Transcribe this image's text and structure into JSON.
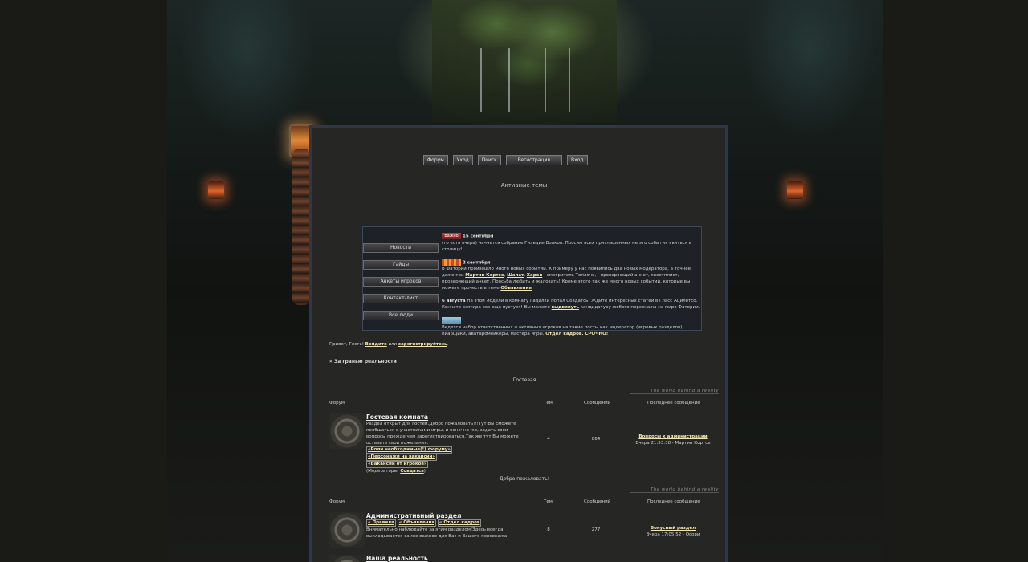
{
  "topnav": [
    "Форум",
    "Уход",
    "Поиск",
    "Регистрация",
    "Вход"
  ],
  "section_title": "Активные темы",
  "news": {
    "menu": [
      "Новости",
      "Гайды",
      "Анкеты игроков",
      "Контакт-лист",
      "Все люди"
    ],
    "items": [
      {
        "badge": "Важно",
        "date": "15 сентября",
        "text": "(то есть вчера) начнется собрание Гильдии Волков. Просим всех приглашенных не это события явиться в столицу!"
      },
      {
        "badge": "",
        "date": "2 сентября",
        "text": "В Фатории произошло много новых событий. К примеру у нас появились два новых модератора, а точнее даже три",
        "names": [
          "Мартин Кортсе",
          "Шапат",
          "Харон"
        ],
        "text2": "- смотритель Толлочо, - проверяющий анкет, квестплист, - проверяющий анкет. Просьба любить и жаловать! Кроме этого так же много новых событий, которые вы можете прочесть в теме",
        "link": "Объявления"
      },
      {
        "date": "6 августа",
        "text": "На этой модели в комнату Гадалки попал Совдатсь! Ждите интересных статей в Гласс Ацилотсо. Конкатв взятира все еще пустует! Вы можете",
        "link": "выдвинуть",
        "text2": "кандидатуру любого персонажа на мире Фатории."
      },
      {
        "text": "Ведется набор ответственных и активных игроков на такие посты как модератор (игровых разделов), пиарщики, аватаромейкеры, мастера игры.",
        "link": "Отдел кадров. СРОЧНО!"
      }
    ]
  },
  "welcome": {
    "prefix": "Привет, Гость!",
    "login": "Войдите",
    "or": "или",
    "register": "зарегистрируйтесь",
    "dot": "."
  },
  "breadcrumb": "» За гранью реальности",
  "ornament_text": "The world behind a reality",
  "table_headers": {
    "forum": "Форум",
    "topics": "Тем",
    "posts": "Сообщений",
    "last": "Последнее сообщение"
  },
  "categories": [
    {
      "title": "Гостевая",
      "forums": [
        {
          "name": "Гостевая комната",
          "desc": "Раздел открыт для гостей.Добро пожаловать!!!Тут Вы сможете пообщаться с участниками игры, и конечно же, задать свои вопросы прежде чем зарегистрироваться.Так же тут Вы можете оставить свои пожелания.",
          "tags": [
            "«Роли необходимые(!) форуму»",
            "«Персонажи на вакансии»",
            "«Вакансии от игроков»"
          ],
          "mods_label": "(Модераторы:",
          "mods": "Совдатсь",
          "mods_end": ")",
          "topics": "4",
          "posts": "864",
          "last_title": "Вопросы к администрации",
          "last_meta": "Вчера 21:53:38 - Мартин Кортсе"
        }
      ]
    },
    {
      "title": "Добро пожаловать!",
      "forums": [
        {
          "name": "Административный раздел",
          "tags": [
            "« Правила",
            "« Объявления",
            "« Отдел кадров"
          ],
          "desc": "Внимательно наблюдайте за этим разделом!Здесь всегда выкладывается самое важное для Вас и Вашего персонажа",
          "topics": "8",
          "posts": "277",
          "last_title": "Бонусный раздел",
          "last_meta": "Вчера 17:05:52 - Осори"
        },
        {
          "name": "Наша реальность"
        }
      ]
    }
  ],
  "colors": {
    "panel_bg": "#262624",
    "link_gold": "#f1e6b0",
    "border_blue": "#2f3748"
  }
}
